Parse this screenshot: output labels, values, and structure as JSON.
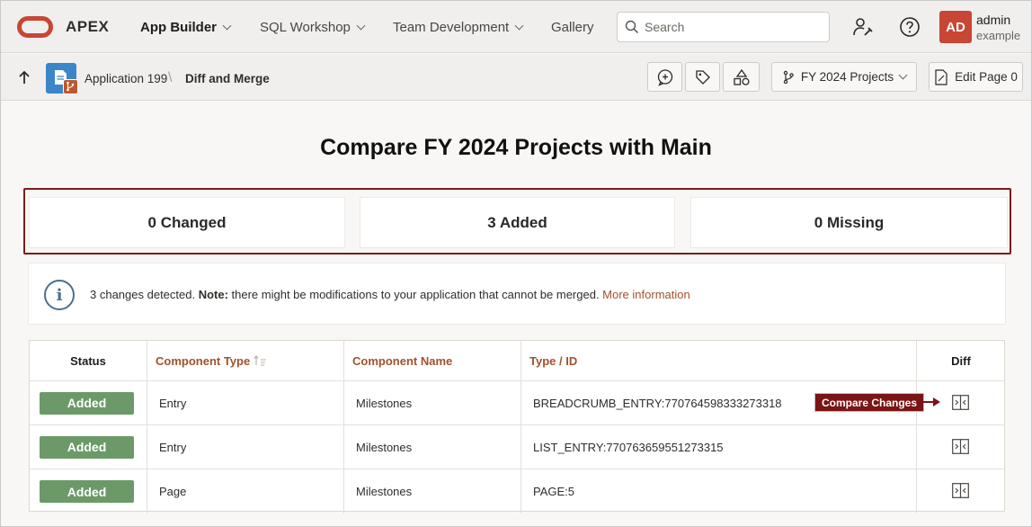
{
  "topbar": {
    "brand": "APEX",
    "nav": [
      {
        "label": "App Builder",
        "active": true
      },
      {
        "label": "SQL Workshop",
        "active": false
      },
      {
        "label": "Team Development",
        "active": false
      },
      {
        "label": "Gallery",
        "active": false
      }
    ],
    "search_placeholder": "Search",
    "user": {
      "initials": "AD",
      "name": "admin",
      "workspace": "example"
    }
  },
  "breadcrumb": {
    "app": "Application 199",
    "separator": "\\",
    "current": "Diff and Merge",
    "toolbar": {
      "branch_label": "FY 2024 Projects",
      "edit_page_label": "Edit Page 0"
    }
  },
  "main": {
    "title": "Compare FY 2024 Projects with Main",
    "summary": [
      {
        "label": "0 Changed"
      },
      {
        "label": "3 Added"
      },
      {
        "label": "0 Missing"
      }
    ],
    "info": {
      "text": "3 changes detected. ",
      "note_label": "Note:",
      "note_text": " there might be modifications to your application that cannot be merged. ",
      "link": "More information"
    },
    "table": {
      "columns": [
        "Status",
        "Component Type",
        "Component Name",
        "Type / ID",
        "Diff"
      ],
      "rows": [
        {
          "status": "Added",
          "component_type": "Entry",
          "component_name": "Milestones",
          "type_id": "BREADCRUMB_ENTRY:770764598333273318"
        },
        {
          "status": "Added",
          "component_type": "Entry",
          "component_name": "Milestones",
          "type_id": "LIST_ENTRY:770763659551273315"
        },
        {
          "status": "Added",
          "component_type": "Page",
          "component_name": "Milestones",
          "type_id": "PAGE:5"
        }
      ]
    },
    "callout": "Compare Changes"
  },
  "colors": {
    "brand_red": "#c74634",
    "added_badge": "#6b9a68",
    "callout": "#7b1414",
    "link": "#a0522d"
  }
}
